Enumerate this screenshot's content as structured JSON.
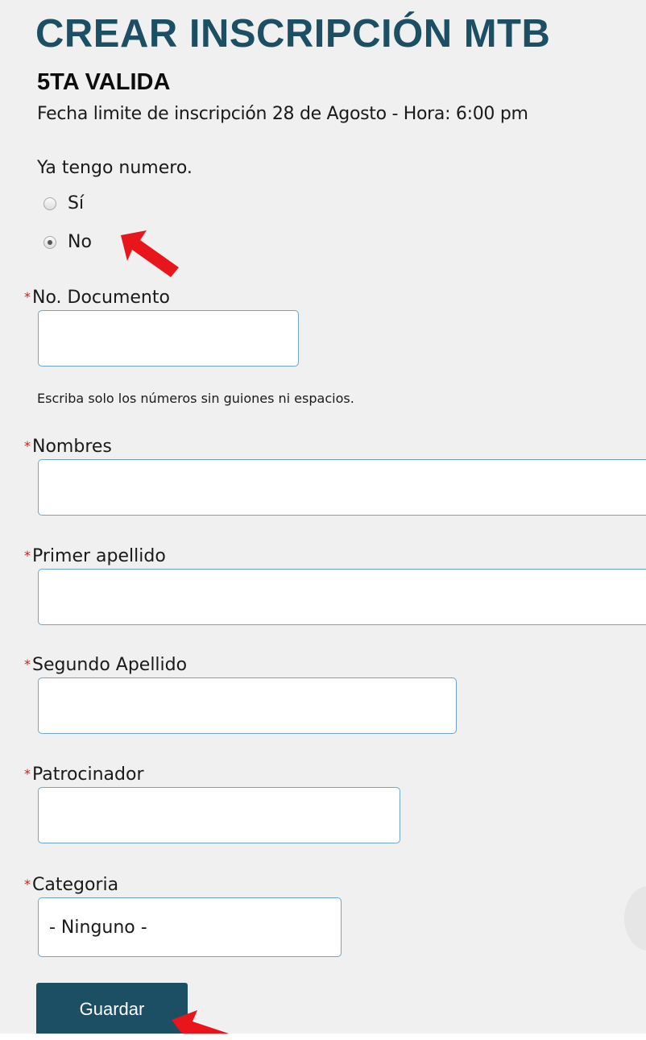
{
  "form": {
    "title": "CREAR INSCRIPCIÓN MTB",
    "subtitle": "5TA VALIDA",
    "deadline": "Fecha limite de inscripción 28 de Agosto - Hora: 6:00 pm",
    "question": "Ya tengo numero.",
    "options": [
      {
        "label": "Sí",
        "checked": false
      },
      {
        "label": "No",
        "checked": true
      }
    ],
    "required_mark": "*",
    "fields": {
      "documento": {
        "label": "No. Documento",
        "value": "",
        "hint": "Escriba solo los números sin guiones ni espacios."
      },
      "nombres": {
        "label": "Nombres",
        "value": ""
      },
      "primer_apellido": {
        "label": "Primer apellido",
        "value": ""
      },
      "segundo_apellido": {
        "label": "Segundo Apellido",
        "value": ""
      },
      "patrocinador": {
        "label": "Patrocinador",
        "value": ""
      },
      "categoria": {
        "label": "Categoria",
        "selected": "- Ninguno -"
      }
    },
    "save_label": "Guardar"
  },
  "colors": {
    "accent": "#1c4f63",
    "required": "#cc1e1e",
    "input_border": "#6fa5c9",
    "annotation_arrow": "#e8151b",
    "background": "#f0f0f0"
  }
}
